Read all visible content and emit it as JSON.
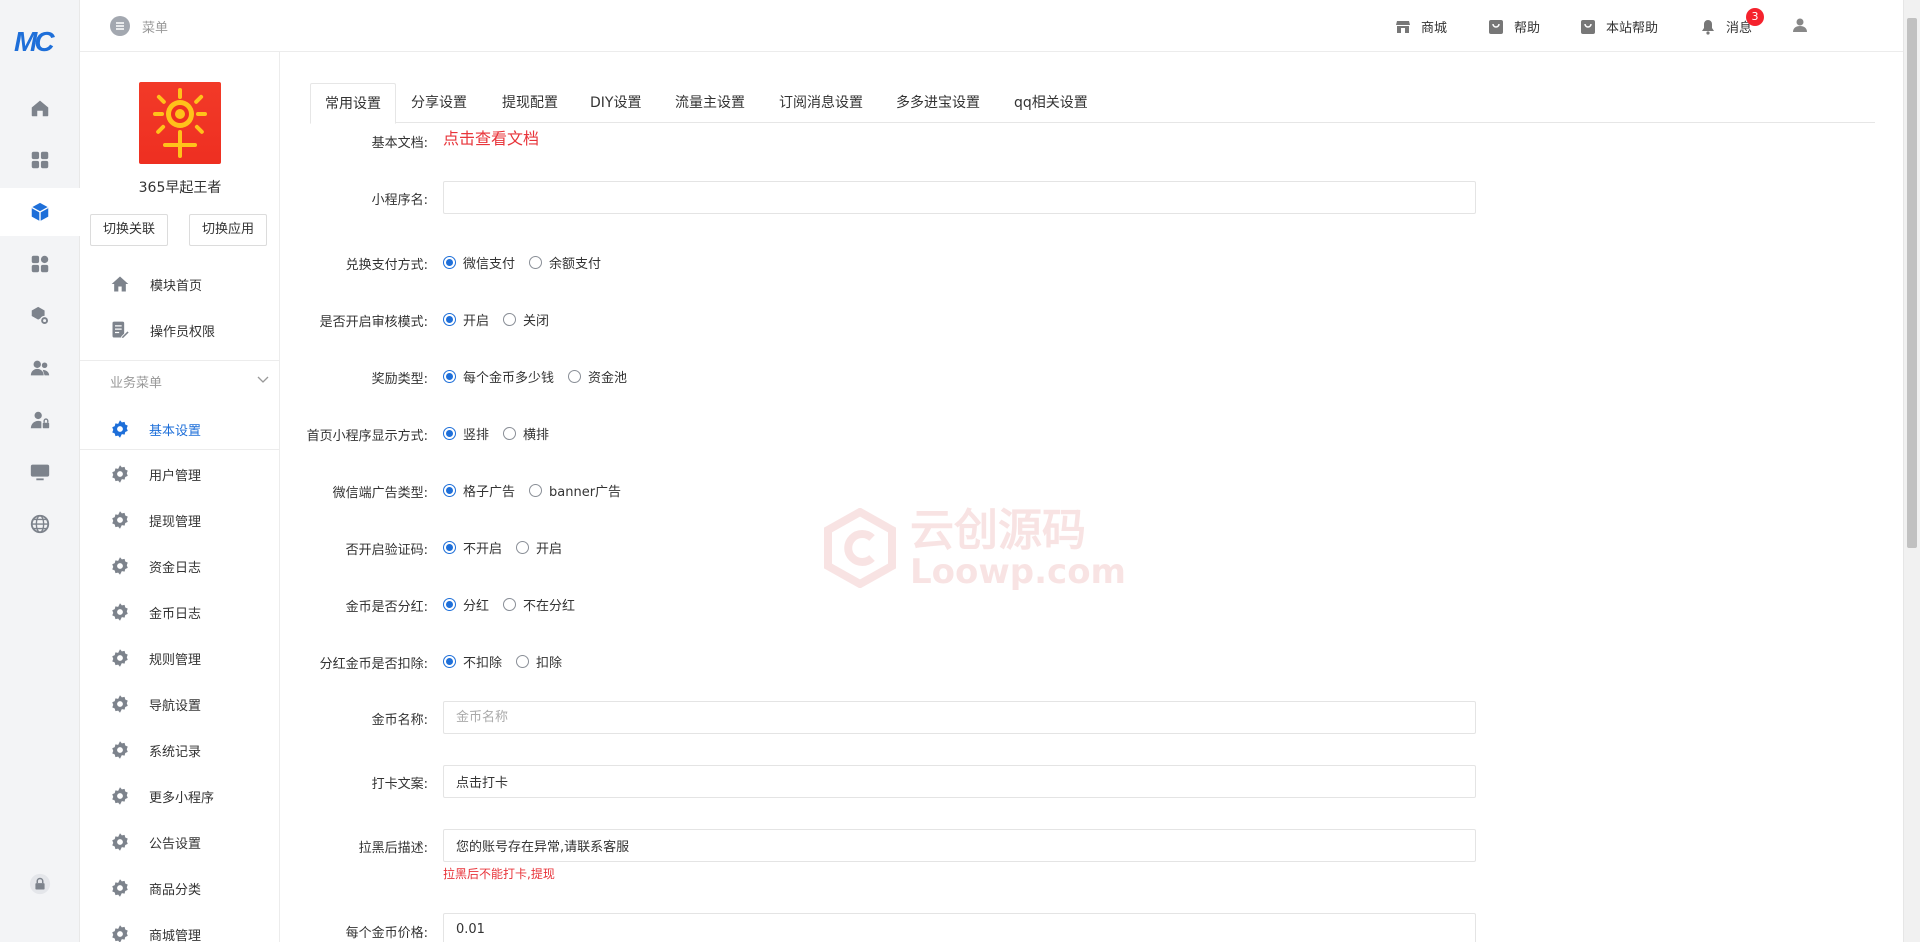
{
  "rail": {
    "logo_text": "MC",
    "items": [
      {
        "icon": "home-icon"
      },
      {
        "icon": "grid-icon"
      },
      {
        "icon": "cube-icon"
      },
      {
        "icon": "apps-icon"
      },
      {
        "icon": "package-settings-icon"
      },
      {
        "icon": "users-icon"
      },
      {
        "icon": "user-lock-icon"
      },
      {
        "icon": "monitor-icon"
      },
      {
        "icon": "globe-icon"
      }
    ],
    "bottom_icon": "lock-icon"
  },
  "header": {
    "menu_label": "菜单",
    "links": [
      {
        "label": "商城",
        "icon": "store-icon"
      },
      {
        "label": "帮助",
        "icon": "bag-icon"
      },
      {
        "label": "本站帮助",
        "icon": "bag-icon"
      },
      {
        "label": "消息",
        "icon": "bell-icon",
        "badge": "3"
      }
    ],
    "user_icon": "user-icon"
  },
  "sidebar": {
    "app_name": "365早起王者",
    "switch_link_label": "切换关联",
    "switch_app_label": "切换应用",
    "top_links": [
      {
        "label": "模块首页",
        "icon": "home-icon"
      },
      {
        "label": "操作员权限",
        "icon": "edit-doc-icon"
      }
    ],
    "section_title": "业务菜单",
    "items": [
      {
        "label": "基本设置"
      },
      {
        "label": "用户管理"
      },
      {
        "label": "提现管理"
      },
      {
        "label": "资金日志"
      },
      {
        "label": "金币日志"
      },
      {
        "label": "规则管理"
      },
      {
        "label": "导航设置"
      },
      {
        "label": "系统记录"
      },
      {
        "label": "更多小程序"
      },
      {
        "label": "公告设置"
      },
      {
        "label": "商品分类"
      },
      {
        "label": "商城管理"
      }
    ],
    "active_index": 0
  },
  "tabs": [
    "常用设置",
    "分享设置",
    "提现配置",
    "DIY设置",
    "流量主设置",
    "订阅消息设置",
    "多多进宝设置",
    "qq相关设置"
  ],
  "active_tab": 0,
  "form": {
    "doc_label": "基本文档:",
    "doc_link": "点击查看文档",
    "miniapp_name_label": "小程序名:",
    "miniapp_name_value": "",
    "radio_rows": [
      {
        "label": "兑换支付方式:",
        "options": [
          "微信支付",
          "余额支付"
        ],
        "selected": 0
      },
      {
        "label": "是否开启审核模式:",
        "options": [
          "开启",
          "关闭"
        ],
        "selected": 0
      },
      {
        "label": "奖励类型:",
        "options": [
          "每个金币多少钱",
          "资金池"
        ],
        "selected": 0
      },
      {
        "label": "首页小程序显示方式:",
        "options": [
          "竖排",
          "横排"
        ],
        "selected": 0
      },
      {
        "label": "微信端广告类型:",
        "options": [
          "格子广告",
          "banner广告"
        ],
        "selected": 0
      },
      {
        "label": "否开启验证码:",
        "options": [
          "不开启",
          "开启"
        ],
        "selected": 0
      },
      {
        "label": "金币是否分红:",
        "options": [
          "分红",
          "不在分红"
        ],
        "selected": 0
      },
      {
        "label": "分红金币是否扣除:",
        "options": [
          "不扣除",
          "扣除"
        ],
        "selected": 0
      }
    ],
    "coin_name_label": "金币名称:",
    "coin_name_placeholder": "金币名称",
    "checkin_text_label": "打卡文案:",
    "checkin_text_value": "点击打卡",
    "blacklist_label": "拉黑后描述:",
    "blacklist_value": "您的账号存在异常,请联系客服",
    "blacklist_hint": "拉黑后不能打卡,提现",
    "coin_price_label": "每个金币价格:",
    "coin_price_value": "0.01"
  },
  "watermark": {
    "cn": "云创源码",
    "en": "Loowp.com"
  },
  "colors": {
    "accent": "#1e6fd9",
    "danger": "#e8343a"
  }
}
